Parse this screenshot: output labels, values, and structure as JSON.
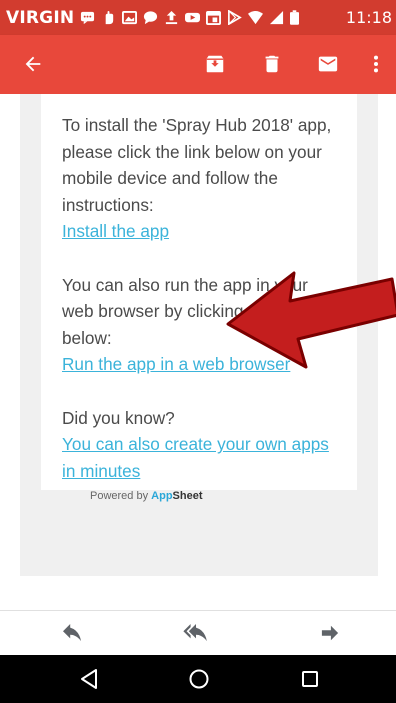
{
  "status_bar": {
    "carrier": "VIRGIN",
    "time": "11:18",
    "icons": [
      "message-icon",
      "hand-icon",
      "image-icon",
      "chat-icon",
      "upload-icon",
      "youtube-icon",
      "calendar-icon",
      "play-store-icon",
      "wifi-icon",
      "signal-icon",
      "battery-icon"
    ]
  },
  "app_bar": {
    "icons": [
      "back-arrow-icon",
      "archive-icon",
      "trash-icon",
      "mail-icon",
      "more-vert-icon"
    ]
  },
  "email": {
    "para1": [
      "To install the 'Spray Hub 2018' app,",
      "please click the link below on your",
      "mobile device and follow the",
      "instructions:"
    ],
    "install_link": "Install the app",
    "para2": [
      "You can also run the app in your",
      "web browser by clicking the link",
      "below:"
    ],
    "run_link": "Run the app in a web browser",
    "did_you_know": "Did you know?",
    "create_link": [
      "You can also create your own apps",
      "in minutes"
    ],
    "powered_prefix": "Powered by ",
    "brand_app": "App",
    "brand_sheet": "Sheet"
  },
  "actions": {
    "icons": [
      "reply-icon",
      "reply-all-icon",
      "forward-icon"
    ]
  },
  "nav_bar": {
    "icons": [
      "back-triangle-icon",
      "home-circle-icon",
      "recents-square-icon"
    ]
  },
  "colors": {
    "status_bar": "#d23c2f",
    "app_bar": "#e8483b",
    "link": "#3bb3da",
    "arrow": "#c41e1e"
  }
}
